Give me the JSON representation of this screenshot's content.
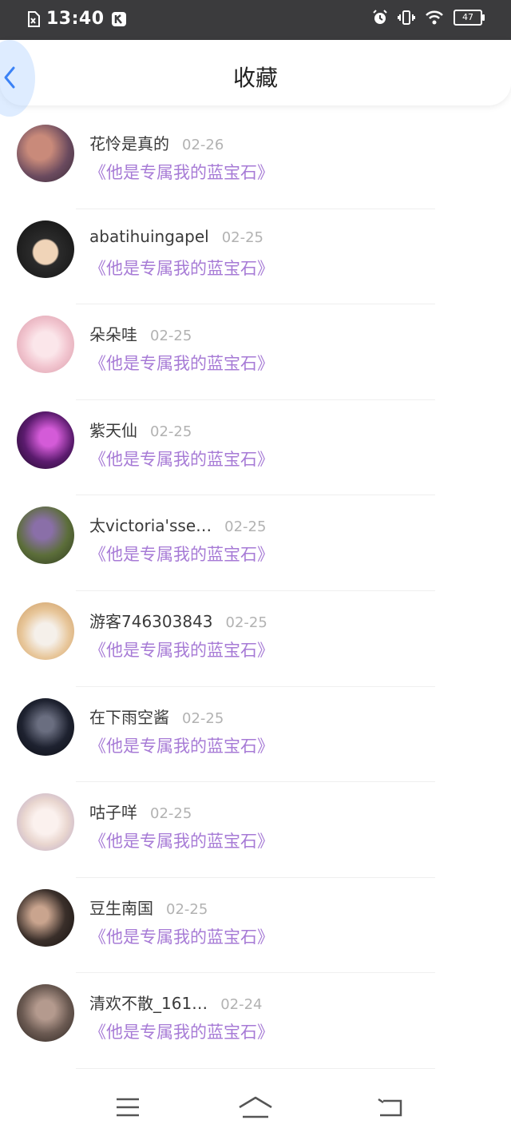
{
  "status": {
    "time": "13:40",
    "battery": "47"
  },
  "header": {
    "title": "收藏"
  },
  "items": [
    {
      "name": "花怜是真的",
      "date": "02-26",
      "book": "《他是专属我的蓝宝石》",
      "avatar_color": "#6a4a5e"
    },
    {
      "name": "abatihuingapel",
      "date": "02-25",
      "book": "《他是专属我的蓝宝石》",
      "avatar_color": "#2b2b2b"
    },
    {
      "name": "朵朵哇",
      "date": "02-25",
      "book": "《他是专属我的蓝宝石》",
      "avatar_color": "#f2c6d0"
    },
    {
      "name": "紫天仙",
      "date": "02-25",
      "book": "《他是专属我的蓝宝石》",
      "avatar_color": "#5b1b6e"
    },
    {
      "name": "太victoria'sse…",
      "date": "02-25",
      "book": "《他是专属我的蓝宝石》",
      "avatar_color": "#5c6e3a"
    },
    {
      "name": "游客746303843",
      "date": "02-25",
      "book": "《他是专属我的蓝宝石》",
      "avatar_color": "#e8c79b"
    },
    {
      "name": "在下雨空酱",
      "date": "02-25",
      "book": "《他是专属我的蓝宝石》",
      "avatar_color": "#1e2230"
    },
    {
      "name": "咕子咩",
      "date": "02-25",
      "book": "《他是专属我的蓝宝石》",
      "avatar_color": "#e9d6cf"
    },
    {
      "name": "豆生南国",
      "date": "02-25",
      "book": "《他是专属我的蓝宝石》",
      "avatar_color": "#3a2f2a"
    },
    {
      "name": "清欢不散_161…",
      "date": "02-24",
      "book": "《他是专属我的蓝宝石》",
      "avatar_color": "#6b5a52"
    }
  ]
}
